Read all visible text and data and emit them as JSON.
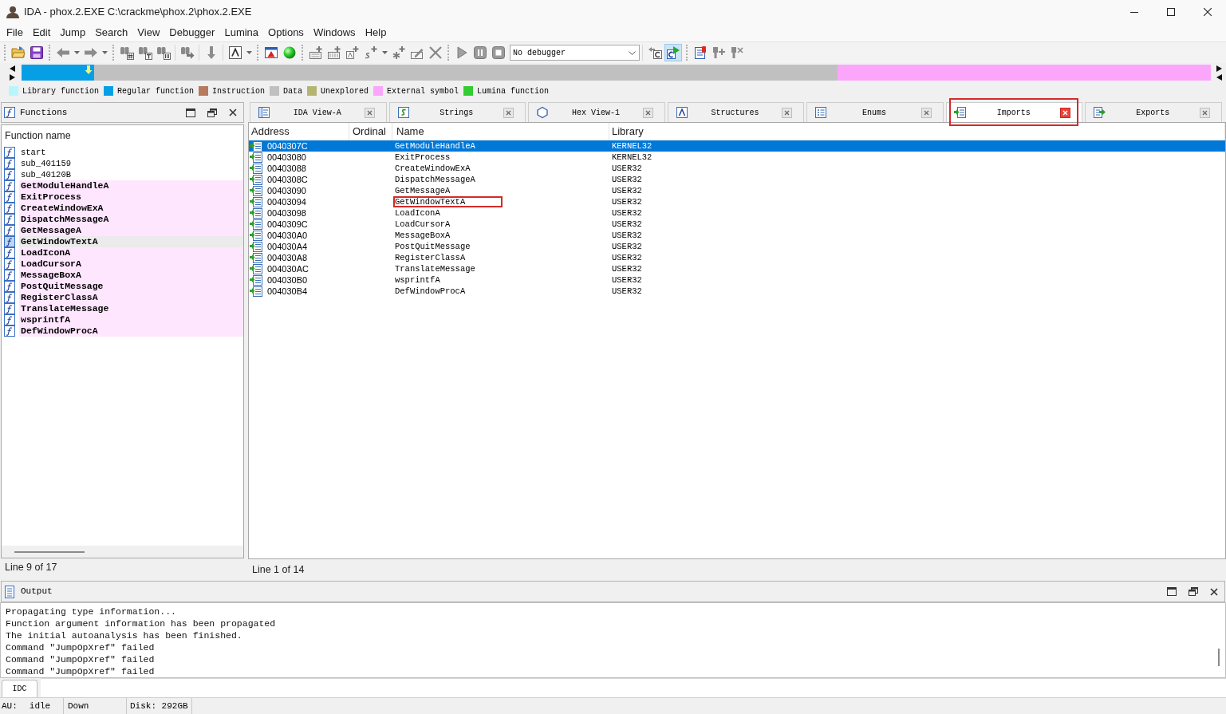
{
  "window": {
    "title": "IDA - phox.2.EXE C:\\crackme\\phox.2\\phox.2.EXE"
  },
  "menu": [
    "File",
    "Edit",
    "Jump",
    "Search",
    "View",
    "Debugger",
    "Lumina",
    "Options",
    "Windows",
    "Help"
  ],
  "toolbar": {
    "debugger": "No debugger",
    "toggle": {
      "on": true
    }
  },
  "legend": [
    {
      "label": "Library function",
      "color": "#b9f6fb"
    },
    {
      "label": "Regular function",
      "color": "#069fe6"
    },
    {
      "label": "Instruction",
      "color": "#b67a5c"
    },
    {
      "label": "Data",
      "color": "#c0c0c0"
    },
    {
      "label": "Unexplored",
      "color": "#b5b573"
    },
    {
      "label": "External symbol",
      "color": "#fba6fb"
    },
    {
      "label": "Lumina function",
      "color": "#33cc33"
    }
  ],
  "functions_panel": {
    "title": "Functions",
    "column": "Function name",
    "items": [
      {
        "name": "start",
        "kind": "regular",
        "selected": false
      },
      {
        "name": "sub_401159",
        "kind": "regular",
        "selected": false
      },
      {
        "name": "sub_40120B",
        "kind": "regular",
        "selected": false
      },
      {
        "name": "GetModuleHandleA",
        "kind": "external",
        "selected": false
      },
      {
        "name": "ExitProcess",
        "kind": "external",
        "selected": false
      },
      {
        "name": "CreateWindowExA",
        "kind": "external",
        "selected": false
      },
      {
        "name": "DispatchMessageA",
        "kind": "external",
        "selected": false
      },
      {
        "name": "GetMessageA",
        "kind": "external",
        "selected": false
      },
      {
        "name": "GetWindowTextA",
        "kind": "external",
        "selected": true
      },
      {
        "name": "LoadIconA",
        "kind": "external",
        "selected": false
      },
      {
        "name": "LoadCursorA",
        "kind": "external",
        "selected": false
      },
      {
        "name": "MessageBoxA",
        "kind": "external",
        "selected": false
      },
      {
        "name": "PostQuitMessage",
        "kind": "external",
        "selected": false
      },
      {
        "name": "RegisterClassA",
        "kind": "external",
        "selected": false
      },
      {
        "name": "TranslateMessage",
        "kind": "external",
        "selected": false
      },
      {
        "name": "wsprintfA",
        "kind": "external",
        "selected": false
      },
      {
        "name": "DefWindowProcA",
        "kind": "external",
        "selected": false
      }
    ],
    "status": "Line 9 of 17"
  },
  "tabs": [
    {
      "label": "IDA View-A",
      "kind": "disassembly",
      "selected": false,
      "outlined": false
    },
    {
      "label": "Strings",
      "kind": "strings",
      "selected": false,
      "outlined": false
    },
    {
      "label": "Hex View-1",
      "kind": "hex",
      "selected": false,
      "outlined": false
    },
    {
      "label": "Structures",
      "kind": "structures",
      "selected": false,
      "outlined": false
    },
    {
      "label": "Enums",
      "kind": "enums",
      "selected": false,
      "outlined": false
    },
    {
      "label": "Imports",
      "kind": "imports",
      "selected": true,
      "outlined": true
    },
    {
      "label": "Exports",
      "kind": "exports",
      "selected": false,
      "outlined": false
    }
  ],
  "imports": {
    "columns": [
      "Address",
      "Ordinal",
      "Name",
      "Library"
    ],
    "rows": [
      {
        "address": "0040307C",
        "name": "GetModuleHandleA",
        "library": "KERNEL32",
        "selected": true,
        "outlined": false
      },
      {
        "address": "00403080",
        "name": "ExitProcess",
        "library": "KERNEL32",
        "selected": false,
        "outlined": false
      },
      {
        "address": "00403088",
        "name": "CreateWindowExA",
        "library": "USER32",
        "selected": false,
        "outlined": false
      },
      {
        "address": "0040308C",
        "name": "DispatchMessageA",
        "library": "USER32",
        "selected": false,
        "outlined": false
      },
      {
        "address": "00403090",
        "name": "GetMessageA",
        "library": "USER32",
        "selected": false,
        "outlined": false
      },
      {
        "address": "00403094",
        "name": "GetWindowTextA",
        "library": "USER32",
        "selected": false,
        "outlined": true
      },
      {
        "address": "00403098",
        "name": "LoadIconA",
        "library": "USER32",
        "selected": false,
        "outlined": false
      },
      {
        "address": "0040309C",
        "name": "LoadCursorA",
        "library": "USER32",
        "selected": false,
        "outlined": false
      },
      {
        "address": "004030A0",
        "name": "MessageBoxA",
        "library": "USER32",
        "selected": false,
        "outlined": false
      },
      {
        "address": "004030A4",
        "name": "PostQuitMessage",
        "library": "USER32",
        "selected": false,
        "outlined": false
      },
      {
        "address": "004030A8",
        "name": "RegisterClassA",
        "library": "USER32",
        "selected": false,
        "outlined": false
      },
      {
        "address": "004030AC",
        "name": "TranslateMessage",
        "library": "USER32",
        "selected": false,
        "outlined": false
      },
      {
        "address": "004030B0",
        "name": "wsprintfA",
        "library": "USER32",
        "selected": false,
        "outlined": false
      },
      {
        "address": "004030B4",
        "name": "DefWindowProcA",
        "library": "USER32",
        "selected": false,
        "outlined": false
      }
    ],
    "status": "Line 1 of 14"
  },
  "output": {
    "title": "Output",
    "lines": [
      "Propagating type information...",
      "Function argument information has been propagated",
      "The initial autoanalysis has been finished.",
      "Command \"JumpOpXref\" failed",
      "Command \"JumpOpXref\" failed",
      "Command \"JumpOpXref\" failed"
    ]
  },
  "command_bar": {
    "language": "IDC"
  },
  "status_bar": {
    "segments": [
      [
        "AU:",
        "idle"
      ],
      [
        "Down"
      ],
      [
        "Disk: 292GB"
      ]
    ]
  }
}
